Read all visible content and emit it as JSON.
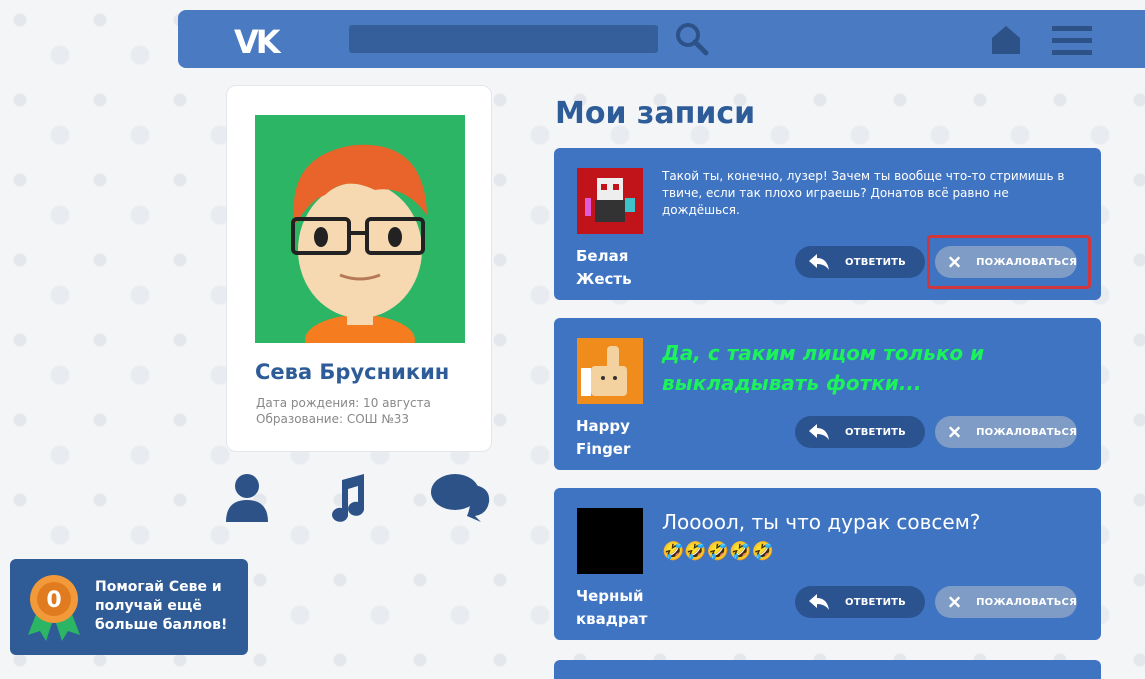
{
  "header": {
    "logo": "VK",
    "search_placeholder": ""
  },
  "profile": {
    "name": "Сева Брусникин",
    "birth": "Дата рождения: 10 августа",
    "education": "Образование: СОШ №33"
  },
  "bonus": {
    "badge_value": "0",
    "text": "Помогай Севе и получай ещё больше баллов!"
  },
  "section_title": "Мои записи",
  "posts": [
    {
      "author": "Белая Жесть",
      "text": "Такой ты, конечно, лузер! Зачем ты вообще что-то стримишь в твиче, если так плохо играешь? Донатов всё равно не дождёшься.",
      "reply_label": "ОТВЕТИТЬ",
      "report_label": "ПОЖАЛОВАТЬСЯ"
    },
    {
      "author": "Happy Finger",
      "text": "Да, с таким лицом только и выкладывать фотки...",
      "reply_label": "ОТВЕТИТЬ",
      "report_label": "ПОЖАЛОВАТЬСЯ"
    },
    {
      "author": "Черный квадрат",
      "text": "Лоооол, ты что дурак совсем?",
      "emoji": "🤣🤣🤣🤣🤣",
      "reply_label": "ОТВЕТИТЬ",
      "report_label": "ПОЖАЛОВАТЬСЯ"
    }
  ],
  "colors": {
    "header": "#4a7ac2",
    "post_bg": "#3f74c2",
    "title": "#2d5c99",
    "highlight": "#d0363a",
    "green_text": "#1cf25a"
  }
}
